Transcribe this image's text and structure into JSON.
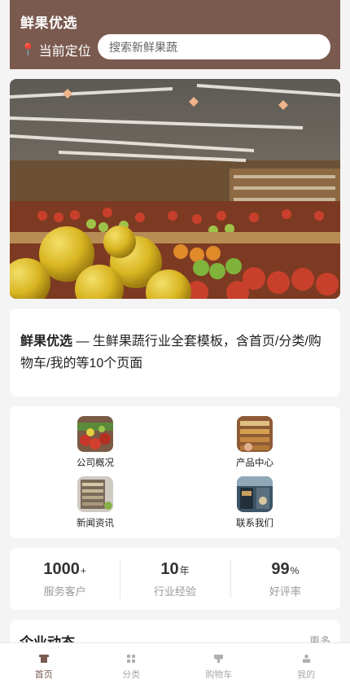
{
  "header": {
    "brand": "鲜果优选",
    "location_label": "当前定位",
    "search_placeholder": "搜索新鲜果蔬"
  },
  "intro": {
    "brand": "鲜果优选",
    "text": " — 生鲜果蔬行业全套模板，含首页/分类/购物车/我的等10个页面"
  },
  "quick_links": [
    {
      "label": "公司概况",
      "icon": "produce-photo-icon"
    },
    {
      "label": "产品中心",
      "icon": "store-photo-icon"
    },
    {
      "label": "新闻资讯",
      "icon": "shelf-photo-icon"
    },
    {
      "label": "联系我们",
      "icon": "storefront-photo-icon"
    }
  ],
  "stats": [
    {
      "value": "1000",
      "unit": "+",
      "label": "服务客户"
    },
    {
      "value": "10",
      "unit": "年",
      "label": "行业经验"
    },
    {
      "value": "99",
      "unit": "%",
      "label": "好评率"
    }
  ],
  "news": {
    "title": "企业动态",
    "more": "更多"
  },
  "tabbar": [
    {
      "label": "首页",
      "icon": "home-icon",
      "active": true
    },
    {
      "label": "分类",
      "icon": "grid-icon",
      "active": false
    },
    {
      "label": "购物车",
      "icon": "cart-icon",
      "active": false
    },
    {
      "label": "我的",
      "icon": "user-icon",
      "active": false
    }
  ],
  "colors": {
    "brand": "#7a5a4f",
    "background": "#f4f4f4",
    "inactive_tab": "#aaaaaa"
  }
}
